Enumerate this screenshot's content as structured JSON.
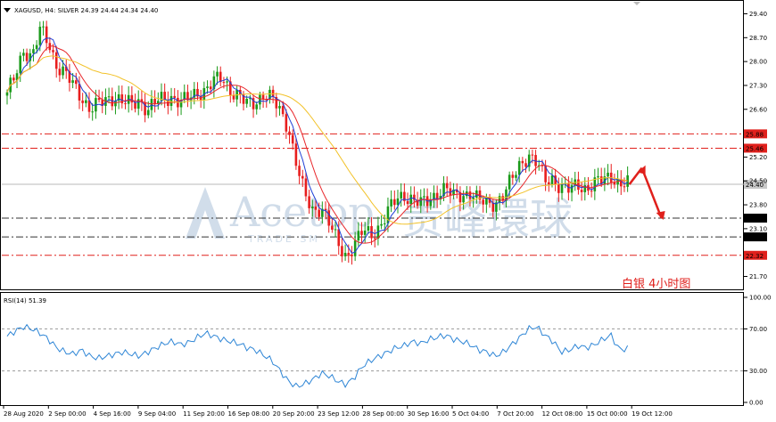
{
  "header": {
    "symbol": "XAGUSD, H4:  SILVER  24.39 24.44 24.34 24.40",
    "annotation": "白银  4小时图"
  },
  "watermark": {
    "latin": "Acetop",
    "chinese": "贵峰環球",
    "sub": "TRADE SM"
  },
  "rsi": {
    "label": "RSI(14) 51.39",
    "ticks": [
      "100.00",
      "70.00",
      "30.00",
      "0.00"
    ],
    "levels": [
      100,
      70,
      30,
      0
    ]
  },
  "x_labels": [
    "28 Aug 2020",
    "2 Sep 00:00",
    "4 Sep 16:00",
    "9 Sep 04:00",
    "11 Sep 20:00",
    "16 Sep 08:00",
    "20 Sep 20:00",
    "23 Sep 12:00",
    "28 Sep 00:00",
    "30 Sep 16:00",
    "5 Oct 04:00",
    "7 Oct 20:00",
    "12 Oct 08:00",
    "15 Oct 00:00",
    "19 Oct 12:00"
  ],
  "price_ticks": [
    "29.40",
    "28.70",
    "28.00",
    "27.30",
    "26.60",
    "25.20",
    "24.50",
    "23.80",
    "23.10",
    "21.70"
  ],
  "price_tick_values": [
    29.4,
    28.7,
    28.0,
    27.3,
    26.6,
    25.2,
    24.5,
    23.8,
    23.1,
    21.7
  ],
  "levels": [
    {
      "label": "25.88",
      "value": 25.88,
      "style": "red-dashdot"
    },
    {
      "label": "25.46",
      "value": 25.46,
      "style": "red-dashdot"
    },
    {
      "label": "24.40",
      "value": 24.4,
      "style": "current"
    },
    {
      "label": "23.41",
      "value": 23.41,
      "style": "black-dashdot"
    },
    {
      "label": "22.86",
      "value": 22.86,
      "style": "black-dashdot"
    },
    {
      "label": "22.32",
      "value": 22.32,
      "style": "red-dashdot"
    }
  ],
  "colors": {
    "bull": "#1a9a1a",
    "bear": "#e81e1e",
    "ma_fast": "#1f3fd6",
    "ma_mid": "#e8262a",
    "ma_slow": "#f2c22a",
    "rsi": "#2f86d6",
    "red_level": "#e0201c",
    "black_level": "#333333"
  },
  "chart_data": {
    "type": "candlestick",
    "title": "XAGUSD, H4: SILVER",
    "y_range": [
      21.4,
      29.7
    ],
    "x_range_labels": [
      "28 Aug 2020",
      "19 Oct 12:00"
    ],
    "close_path": [
      27.0,
      27.6,
      28.4,
      28.1,
      28.9,
      28.6,
      27.9,
      27.6,
      27.3,
      27.0,
      26.6,
      26.7,
      26.9,
      27.0,
      26.8,
      26.7,
      26.9,
      26.6,
      26.8,
      26.9,
      27.0,
      26.8,
      26.9,
      27.1,
      27.2,
      27.4,
      27.5,
      27.2,
      27.0,
      26.7,
      26.8,
      27.1,
      26.9,
      26.5,
      26.1,
      25.0,
      24.0,
      23.6,
      23.8,
      23.2,
      22.6,
      22.3,
      22.7,
      23.0,
      22.9,
      23.2,
      23.6,
      23.9,
      24.1,
      24.0,
      23.8,
      23.9,
      24.2,
      24.3,
      24.0,
      24.1,
      24.2,
      23.9,
      23.8,
      23.9,
      24.1,
      24.5,
      25.0,
      25.3,
      25.0,
      24.5,
      24.6,
      24.3,
      24.2,
      24.4,
      24.3,
      24.4,
      24.5,
      24.7,
      24.4,
      24.4
    ],
    "arrow_path": [
      24.4,
      24.88,
      23.41
    ],
    "rsi_path": [
      63,
      68,
      72,
      70,
      66,
      60,
      52,
      48,
      46,
      50,
      44,
      42,
      44,
      46,
      48,
      46,
      44,
      48,
      52,
      56,
      58,
      55,
      57,
      62,
      66,
      63,
      60,
      58,
      56,
      52,
      50,
      45,
      40,
      30,
      20,
      15,
      18,
      22,
      28,
      25,
      20,
      17,
      24,
      35,
      40,
      44,
      48,
      52,
      54,
      58,
      56,
      60,
      62,
      64,
      60,
      58,
      55,
      50,
      48,
      44,
      48,
      55,
      62,
      70,
      72,
      64,
      58,
      48,
      50,
      54,
      52,
      55,
      60,
      64,
      50,
      51.39
    ]
  }
}
